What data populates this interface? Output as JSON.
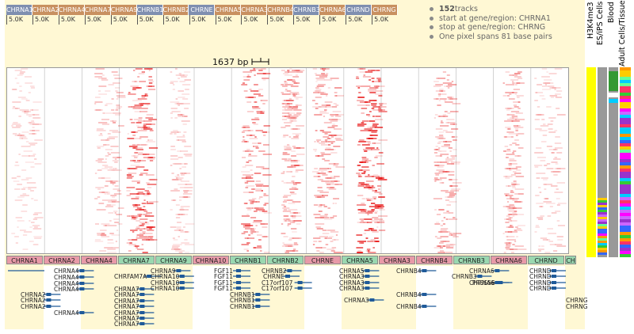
{
  "overview": {
    "genes": [
      {
        "label": "CHRNA1",
        "color": "#7f8fb0"
      },
      {
        "label": "CHRNA2",
        "color": "#c89060"
      },
      {
        "label": "CHRNA4",
        "color": "#c89060"
      },
      {
        "label": "CHRNA7",
        "color": "#c89060"
      },
      {
        "label": "CHRNA9",
        "color": "#c89060"
      },
      {
        "label": "CHRNB1",
        "color": "#7f8fb0"
      },
      {
        "label": "CHRNB2",
        "color": "#c89060"
      },
      {
        "label": "CHRNE",
        "color": "#7f8fb0"
      },
      {
        "label": "CHRNA5",
        "color": "#c89060"
      },
      {
        "label": "CHRNA3",
        "color": "#c89060"
      },
      {
        "label": "CHRNB4",
        "color": "#c89060"
      },
      {
        "label": "CHRNB3",
        "color": "#7f8fb0"
      },
      {
        "label": "CHRNA6",
        "color": "#c89060"
      },
      {
        "label": "CHRND",
        "color": "#7f8fb0"
      },
      {
        "label": "CHRNG",
        "color": "#c89060"
      }
    ],
    "scale_labels": [
      "5.0K",
      "5.0K",
      "5.0K",
      "5.0K",
      "5.0K",
      "5.0K",
      "5.0K",
      "5.0K",
      "5.0K",
      "5.0K",
      "5.0K",
      "5.0K",
      "5.0K",
      "5.0K",
      "5.0K"
    ]
  },
  "info": {
    "tracks_count": "152",
    "tracks_suffix": " tracks",
    "start": "start at gene/region: CHRNA1",
    "stop": "stop at gene/region: CHRNG",
    "pixel": "One pixel spans 81 base pairs"
  },
  "ruler": {
    "label": "1637 bp"
  },
  "side_columns": [
    {
      "label": "H3K4me3",
      "color": "#ffff00"
    },
    {
      "label": "ES/iPS Cells",
      "color": "#999999"
    },
    {
      "label": "Blood",
      "color": "#999999"
    },
    {
      "label": "Adult Cells/Tissues",
      "color": "#999999"
    }
  ],
  "gene_row": [
    {
      "label": "CHRNA1",
      "color": "#e89aa8"
    },
    {
      "label": "CHRNA2",
      "color": "#e89aa8"
    },
    {
      "label": "CHRNA4",
      "color": "#e89aa8"
    },
    {
      "label": "CHRNA7",
      "color": "#9ad8b0"
    },
    {
      "label": "CHRNA9",
      "color": "#9ad8b0"
    },
    {
      "label": "CHRNA10",
      "color": "#e89aa8"
    },
    {
      "label": "CHRNB1",
      "color": "#9ad8b0"
    },
    {
      "label": "CHRNB2",
      "color": "#9ad8b0"
    },
    {
      "label": "CHRNE",
      "color": "#e89aa8"
    },
    {
      "label": "CHRNA5",
      "color": "#9ad8b0"
    },
    {
      "label": "CHRNA3",
      "color": "#e89aa8"
    },
    {
      "label": "CHRNB4",
      "color": "#e89aa8"
    },
    {
      "label": "CHRNB3",
      "color": "#9ad8b0"
    },
    {
      "label": "CHRNA6",
      "color": "#e89aa8"
    },
    {
      "label": "CHRND",
      "color": "#9ad8b0"
    },
    {
      "label": "CH",
      "color": "#9ad8b0"
    }
  ],
  "transcripts": [
    "CHRNA4",
    "CHRNA4",
    "CHRNA4",
    "CHRNA4",
    "CHRNA2",
    "CHRNA2",
    "CHRNA2",
    "CHRNA4",
    "CHRFAM7A",
    "CHRNA7",
    "CHRNA7",
    "CHRNA7",
    "CHRNA7",
    "CHRNA7",
    "CHRNA7",
    "CHRNA7",
    "CHRNA9",
    "CHRNA10",
    "CHRNA10",
    "CHRNA10",
    "FGF11",
    "FGF11",
    "FGF11",
    "FGF11",
    "CHRNB1",
    "CHRNB1",
    "CHRNB1",
    "CHRNB2",
    "CHRNE",
    "C17orf107",
    "C17orf107",
    "CHRNA5",
    "CHRNA3",
    "CHRNA3",
    "CHRNA3",
    "CHRNA3",
    "CHRNB4",
    "CHRNB4",
    "CHRNB4",
    "CHRNB3",
    "CHRNA6",
    "CHRNA6",
    "PRSS56",
    "CHRND",
    "CHRND",
    "CHRND",
    "CHRND",
    "CHRNG",
    "CHRNG"
  ]
}
